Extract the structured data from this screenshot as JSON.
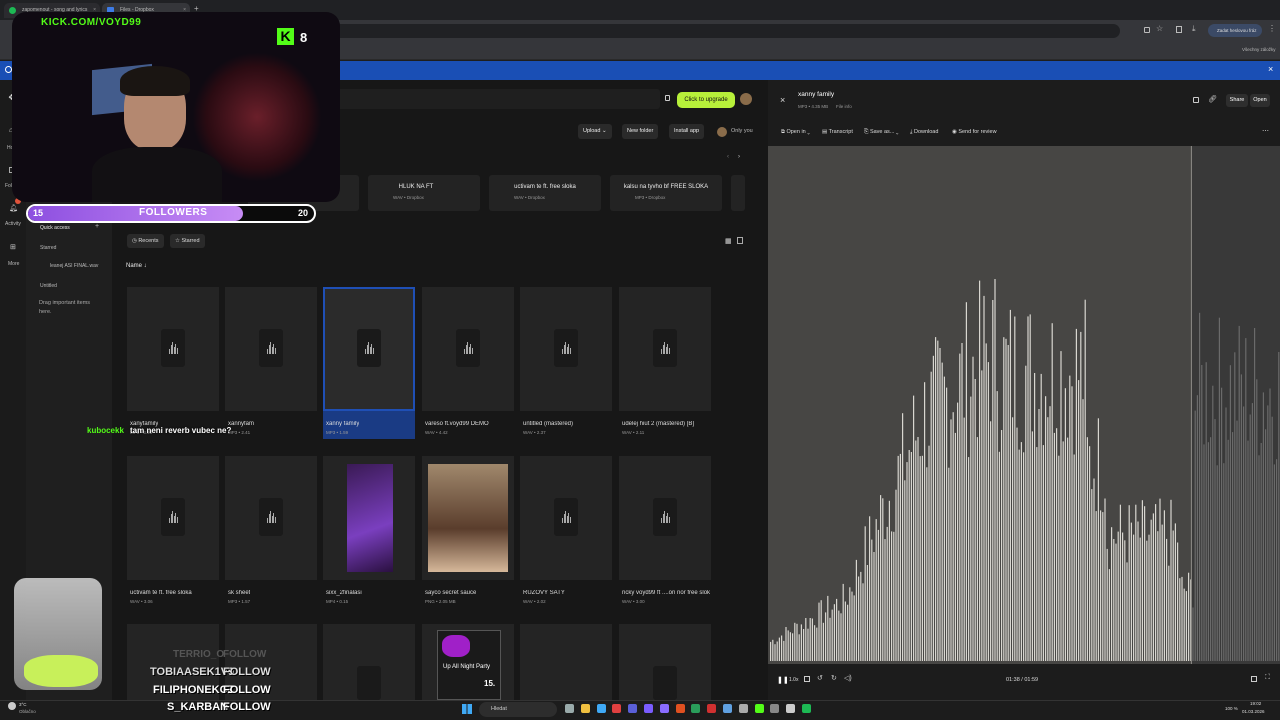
{
  "browser": {
    "tabs": [
      {
        "label": "zapomenout - song and lyrics",
        "color": "#1DB954"
      },
      {
        "label": "Files - Dropbox",
        "color": "#3d7be6"
      }
    ],
    "add_tab": "+",
    "close": "×",
    "profile_button": "Zadat heslovou fráz",
    "bookmarks_all": "Všechny záložky"
  },
  "dropbox": {
    "upgrade_button": "Click to upgrade",
    "toolbar": {
      "upload": "Upload",
      "new_folder": "New folder",
      "install_app": "Install app",
      "only_you": "Only you"
    },
    "rail": {
      "home": "Ho",
      "folders": "Folde",
      "activity": "Activity",
      "more": "More"
    },
    "quick_access": "Quick access",
    "starred_header": "Starred",
    "starred_item": "leanej ASI FINAL.wav",
    "untitled_header": "Untitled",
    "drag_hint": "Drag important items here.",
    "suggested": [
      {
        "title": "",
        "sub": ""
      },
      {
        "title": "HLUK NA FT",
        "sub": "WAV • Dropbox"
      },
      {
        "title": "uctivam te ft. free sloka",
        "sub": "WAV • Dropbox"
      },
      {
        "title": "kalsu na tyvho bf FREE SLOKA",
        "sub": "MP3 • Dropbox"
      }
    ],
    "filters": {
      "recents": "Recents",
      "starred": "Starred"
    },
    "sort_label": "Name",
    "files_row1": [
      {
        "name": "xanyfamily",
        "meta": "MP3 • 3.95"
      },
      {
        "name": "xannyfam",
        "meta": "MP3 • 2.41"
      },
      {
        "name": "xanny family",
        "meta": "MP3 • 1.59"
      },
      {
        "name": "vareso ft.voyd99 DEMO",
        "meta": "WAV • 4.42"
      },
      {
        "name": "untitled (mastered)",
        "meta": "WAV • 2.37"
      },
      {
        "name": "udelej hiut 2 (mastered) [B]",
        "meta": "WAV • 2.11"
      }
    ],
    "files_row2": [
      {
        "name": "uctivam te ft. free sloka",
        "meta": "WAV • 3.06"
      },
      {
        "name": "sk sheet",
        "meta": "MP3 • 1.57"
      },
      {
        "name": "sixx_2finalasi",
        "meta": "MP4 • 0.15"
      },
      {
        "name": "sayco secret sauce",
        "meta": "PNG • 2.05 MB"
      },
      {
        "name": "RUŽOVÝ ŠATY",
        "meta": "WAV • 2.02"
      },
      {
        "name": "ricky voyd99 ft ....on nor free sloka",
        "meta": "WAV • 3.00"
      }
    ],
    "poster_text": "Up All Night Party",
    "poster_num": "15."
  },
  "preview": {
    "file_title": "xanny family",
    "file_meta": "MP3 • 4.35 MB",
    "file_info": "File info",
    "share": "Share",
    "open": "Open",
    "open_in": "Open in",
    "transcript": "Transcript",
    "save_as": "Save as...",
    "download": "Download",
    "send_for_review": "Send for review",
    "speed": "1.0x",
    "time": "01:38 / 01:59",
    "progress": 0.826
  },
  "stream": {
    "kick_url": "KICK.COM/VOYD99",
    "kick_viewers": "8",
    "followers_label": "FOLLOWERS",
    "followers_current": "15",
    "followers_goal": "20",
    "followers_progress": 0.75,
    "chat_user": "kubocekk",
    "chat_msg": "tam neni reverb vubec ne?",
    "follows": [
      {
        "name": "TERRIO_O",
        "action": "FOLLOW"
      },
      {
        "name": "TOBIAASEK1V9",
        "action": "FOLLOW"
      },
      {
        "name": "FILIPHONEKCZ",
        "action": "FOLLOW"
      },
      {
        "name": "S_KARBAN",
        "action": "FOLLOW"
      }
    ]
  },
  "taskbar": {
    "weather": "3°C",
    "weather_sub": "Oblačno",
    "search": "Hledat",
    "battery": "100 %",
    "clock_time": "19:02",
    "clock_date": "01.03.2026"
  }
}
